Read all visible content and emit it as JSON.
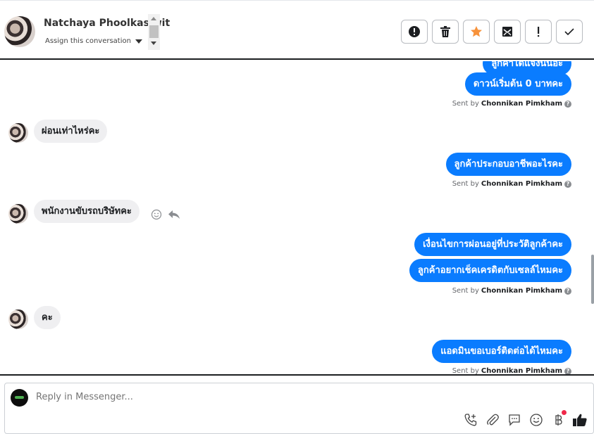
{
  "header": {
    "contact_name": "Natchaya Phoolkasiwit",
    "assign_label": "Assign this conversation",
    "actions": [
      {
        "name": "spam-button",
        "icon": "alert-circle-icon"
      },
      {
        "name": "delete-button",
        "icon": "trash-icon"
      },
      {
        "name": "star-button",
        "icon": "star-icon",
        "color": "#f7923b"
      },
      {
        "name": "mark-unread-button",
        "icon": "mail-icon"
      },
      {
        "name": "follow-up-button",
        "icon": "exclamation-icon"
      },
      {
        "name": "mark-done-button",
        "icon": "check-icon"
      }
    ]
  },
  "thread": {
    "messages": [
      {
        "dir": "out",
        "text": "ลูกค้าได้แจ้งนั่นอะ"
      },
      {
        "dir": "out",
        "text": "ดาวน์เริ่มต้น 0 บาทคะ"
      },
      {
        "dir": "in",
        "text": "ผ่อนเท่าไหร่คะ"
      },
      {
        "dir": "out",
        "text": "ลูกค้าประกอบอาชีพอะไรคะ"
      },
      {
        "dir": "in",
        "text": "พนักงานขับรถบริษัทคะ"
      },
      {
        "dir": "out",
        "text": "เงื่อนไขการผ่อนอยู่ที่ประวัติลูกค้าคะ"
      },
      {
        "dir": "out",
        "text": "ลูกค้าอยากเช็คเครดิตกับเซลล์ไหมคะ"
      },
      {
        "dir": "in",
        "text": "คะ"
      },
      {
        "dir": "out",
        "text": "แอดมินขอเบอร์ติดต่อได้ไหมคะ"
      }
    ],
    "sent_by_prefix": "Sent by",
    "sent_by_name": "Chonnikan Pimkham",
    "help_glyph": "?"
  },
  "composer": {
    "placeholder": "Reply in Messenger...",
    "tools": [
      "phone-plus-icon",
      "paperclip-icon",
      "chat-bubble-icon",
      "smiley-icon",
      "baht-icon",
      "thumbs-up-icon"
    ]
  },
  "colors": {
    "outgoing_bubble": "#0a7cff",
    "incoming_bubble": "#efeff1",
    "star": "#f7923b",
    "notification_dot": "#f02849"
  }
}
